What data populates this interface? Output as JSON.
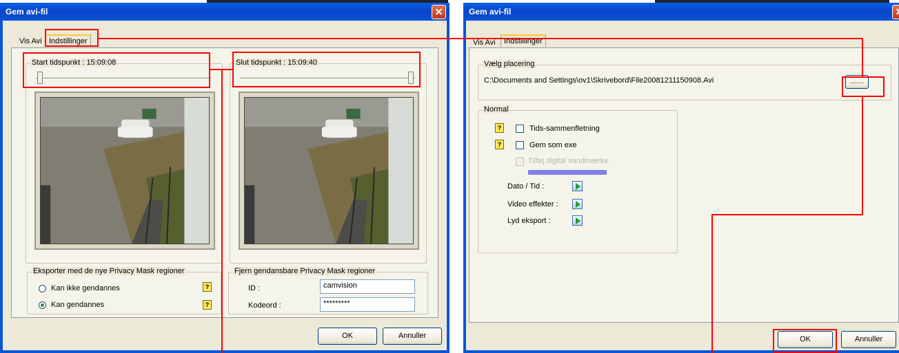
{
  "left_dialog": {
    "title": "Gem avi-fil",
    "close_glyph": "✕",
    "tabs": [
      "Vis Avi",
      "Indstillinger"
    ],
    "start_time_label": "Start tidspunkt : 15:09:08",
    "end_time_label": "Slut tidspunkt : 15:09:40",
    "export_group": {
      "label": "Eksporter med de nye Privacy Mask regioner",
      "options": [
        {
          "label": "Kan ikke gendannes",
          "selected": false
        },
        {
          "label": "Kan gendannes",
          "selected": true
        }
      ]
    },
    "remove_group": {
      "label": "Fjern gendansbare Privacy Mask regioner",
      "id_label": "ID :",
      "id_value": "camvision",
      "password_label": "Kodeord :",
      "password_value": "*********"
    },
    "help_glyph": "?",
    "ok_label": "OK",
    "cancel_label": "Annuller"
  },
  "right_dialog": {
    "title": "Gem avi-fil",
    "tabs": [
      "Vis Avi",
      "Indstillinger"
    ],
    "placement": {
      "label": "Vælg placering",
      "path": "C:\\Documents and Settings\\ov1\\Skrivebord\\File20081211150908.Avi",
      "browse_label": "........"
    },
    "normal": {
      "label": "Normal",
      "time_merge_label": "Tids-sammenfletning",
      "save_exe_label": "Gem som exe",
      "watermark_label": "Tilføj digital vandmærke",
      "date_time_label": "Dato / Tid :",
      "video_effects_label": "Video effekter :",
      "audio_export_label": "Lyd eksport :"
    },
    "help_glyph": "?",
    "ok_label": "OK",
    "cancel_label": "Annuller"
  },
  "colors": {
    "titlebar": "#0a56d8",
    "dialog_face": "#ece9d8",
    "annotation_red": "#ff0000",
    "watermark_bar": "#8080e8"
  }
}
